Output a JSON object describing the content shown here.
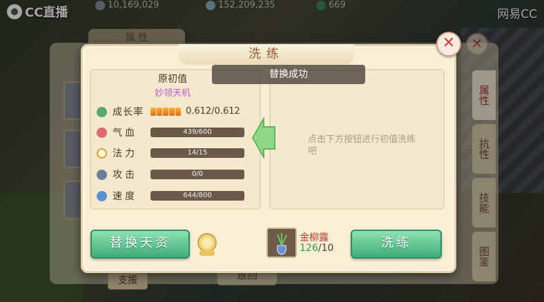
{
  "overlay": {
    "platform_logo": "CC直播",
    "watermark": "网易CC"
  },
  "resources": [
    {
      "icon": "silver-coin-icon",
      "value": "10,169,029"
    },
    {
      "icon": "gem-pile-icon",
      "value": "152,209,235"
    },
    {
      "icon": "jade-icon",
      "value": "669"
    }
  ],
  "background_ui": {
    "top_tab": "属 性",
    "side_tabs": [
      "属性",
      "抗性",
      "技能",
      "图鉴"
    ],
    "support_button": "支援",
    "return_button": "返回"
  },
  "dialog": {
    "title": "洗练",
    "toast": "替换成功",
    "left_panel": {
      "heading": "原初值",
      "pet_name": "妙领天机"
    },
    "stats": [
      {
        "key": "growth",
        "icon": "growth-icon",
        "label": "成长率",
        "value": "0.612/0.612",
        "pips": 5
      },
      {
        "key": "hp",
        "icon": "heart-icon",
        "label": "气血",
        "current": 439,
        "max": 600,
        "text": "439/600"
      },
      {
        "key": "mp",
        "icon": "ring-icon",
        "label": "法力",
        "current": 14,
        "max": 15,
        "text": "14/15"
      },
      {
        "key": "atk",
        "icon": "sword-icon",
        "label": "攻击",
        "current": 0,
        "max": 0,
        "text": "0/0"
      },
      {
        "key": "spd",
        "icon": "boot-icon",
        "label": "速度",
        "current": 644,
        "max": 800,
        "text": "644/800"
      }
    ],
    "right_hint": "点击下方按钮进行初值洗练吧",
    "replace_button": "替换天资",
    "wash_button": "洗练",
    "material": {
      "name": "金柳露",
      "have": "126",
      "need": "/10"
    }
  },
  "colors": {
    "accent_green": "#3fae79",
    "dialog_bg": "#f8efd6",
    "material_name": "#c0392b",
    "pet_name": "#c45bd0"
  }
}
